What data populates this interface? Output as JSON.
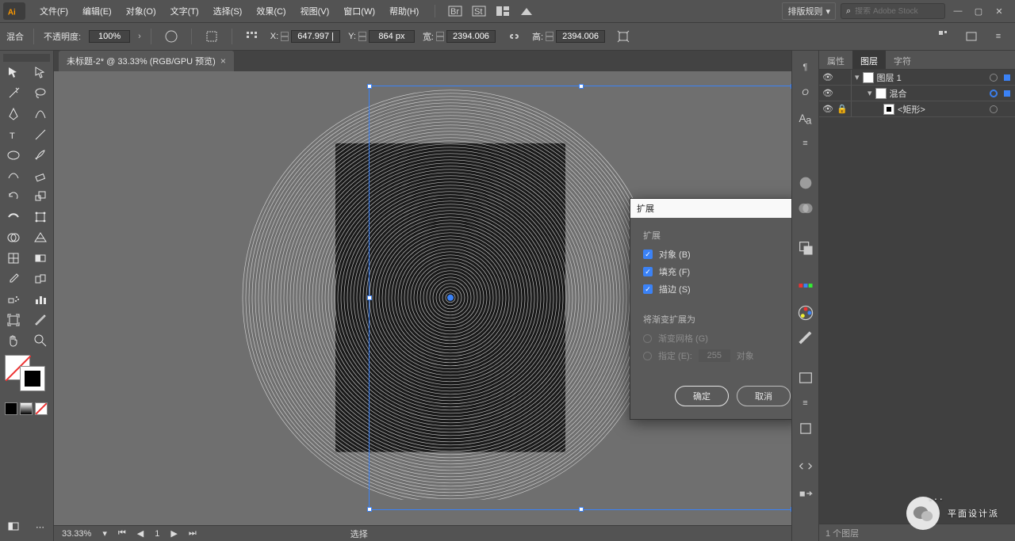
{
  "menu": {
    "file": "文件(F)",
    "edit": "编辑(E)",
    "object": "对象(O)",
    "type": "文字(T)",
    "select": "选择(S)",
    "effect": "效果(C)",
    "view": "视图(V)",
    "window": "窗口(W)",
    "help": "帮助(H)"
  },
  "topbar": {
    "workspace": "排版规则",
    "search_placeholder": "搜索 Adobe Stock"
  },
  "control": {
    "blend": "混合",
    "opacity_label": "不透明度:",
    "opacity_value": "100%",
    "x_label": "X:",
    "x_value": "647.997 |",
    "y_label": "Y:",
    "y_value": "864 px",
    "w_label": "宽:",
    "w_value": "2394.006",
    "h_label": "高:",
    "h_value": "2394.006"
  },
  "tab": {
    "title": "未标题-2* @ 33.33% (RGB/GPU 预览)"
  },
  "statusbar": {
    "zoom": "33.33%",
    "page": "1",
    "mode": "选择"
  },
  "panel": {
    "tab_attr": "属性",
    "tab_layers": "图层",
    "tab_char": "字符",
    "layers": [
      {
        "name": "图层 1",
        "indent": 0,
        "eye": true,
        "lock": false,
        "expand": true,
        "thumb": "#fff",
        "target": "normal",
        "meta": true
      },
      {
        "name": "混合",
        "indent": 1,
        "eye": true,
        "lock": false,
        "expand": true,
        "thumb": "#fff",
        "target": "selected",
        "meta": true
      },
      {
        "name": "<矩形>",
        "indent": 2,
        "eye": true,
        "lock": true,
        "expand": false,
        "thumb_border": true,
        "target": "normal",
        "meta": false
      }
    ],
    "footer": "1 个图层"
  },
  "dialog": {
    "title": "扩展",
    "section": "扩展",
    "object": "对象 (B)",
    "fill": "填充 (F)",
    "stroke": "描边 (S)",
    "gradient_section": "将渐变扩展为",
    "gradient_mesh": "渐变网格 (G)",
    "specify": "指定 (E):",
    "specify_value": "255",
    "specify_unit": "对象",
    "ok": "确定",
    "cancel": "取消"
  },
  "watermark": {
    "text": "平面设计派"
  }
}
